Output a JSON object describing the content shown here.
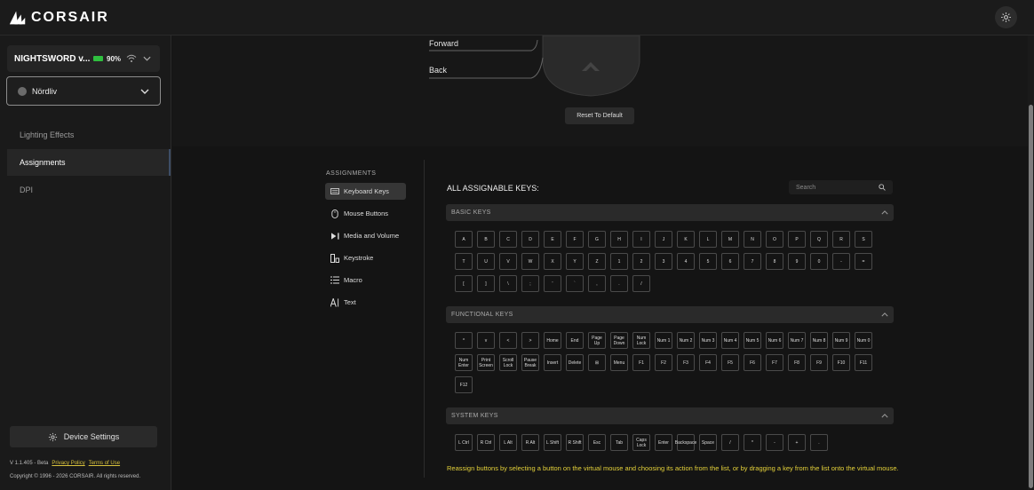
{
  "app": {
    "logo_text": "CORSAIR"
  },
  "device": {
    "name": "NIGHTSWORD v...",
    "battery": "90%"
  },
  "profile": {
    "name": "Nördliv"
  },
  "nav": [
    {
      "label": "Lighting Effects",
      "active": false
    },
    {
      "label": "Assignments",
      "active": true
    },
    {
      "label": "DPI",
      "active": false
    }
  ],
  "device_settings_label": "Device Settings",
  "footer": {
    "version": "V 1.1.405 - Beta",
    "privacy": "Privacy Policy",
    "terms": "Terms of Use",
    "copyright": "Copyright © 1996 - 2026 CORSAIR. All rights reserved."
  },
  "mouse_view": {
    "forward": "Forward",
    "back": "Back",
    "reset": "Reset To Default"
  },
  "assignments": {
    "title": "ASSIGNMENTS",
    "categories": [
      {
        "label": "Keyboard Keys",
        "icon": "keyboard-icon",
        "active": true
      },
      {
        "label": "Mouse Buttons",
        "icon": "mouse-icon",
        "active": false
      },
      {
        "label": "Media and Volume",
        "icon": "media-icon",
        "active": false
      },
      {
        "label": "Keystroke",
        "icon": "keystroke-icon",
        "active": false
      },
      {
        "label": "Macro",
        "icon": "macro-icon",
        "active": false
      },
      {
        "label": "Text",
        "icon": "text-icon",
        "active": false
      }
    ]
  },
  "keys_panel": {
    "title": "ALL ASSIGNABLE KEYS:",
    "search_placeholder": "Search",
    "sections": [
      {
        "title": "BASIC KEYS",
        "rows": [
          [
            "A",
            "B",
            "C",
            "D",
            "E",
            "F",
            "G",
            "H",
            "I",
            "J",
            "K",
            "L",
            "M",
            "N",
            "O",
            "P",
            "Q",
            "R",
            "S"
          ],
          [
            "T",
            "U",
            "V",
            "W",
            "X",
            "Y",
            "Z",
            "1",
            "2",
            "3",
            "4",
            "5",
            "6",
            "7",
            "8",
            "9",
            "0",
            "-",
            "="
          ],
          [
            "[",
            "]",
            "\\",
            ";",
            "'",
            "`",
            ",",
            ".",
            "/"
          ]
        ]
      },
      {
        "title": "FUNCTIONAL KEYS",
        "rows": [
          [
            "^",
            "v",
            "<",
            ">",
            "Home",
            "End",
            "Page Up",
            "Page Down",
            "Num Lock",
            "Num 1",
            "Num 2",
            "Num 3",
            "Num 4",
            "Num 5",
            "Num 6",
            "Num 7",
            "Num 8",
            "Num 9",
            "Num 0"
          ],
          [
            "Num Enter",
            "Print Screen",
            "Scroll Lock",
            "Pause Break",
            "Insert",
            "Delete",
            "⊞",
            "Menu",
            "F1",
            "F2",
            "F3",
            "F4",
            "F5",
            "F6",
            "F7",
            "F8",
            "F9",
            "F10",
            "F11"
          ],
          [
            "F12"
          ]
        ]
      },
      {
        "title": "SYSTEM KEYS",
        "rows": [
          [
            "L Ctrl",
            "R Ctrl",
            "L Alt",
            "R Alt",
            "L Shift",
            "R Shift",
            "Esc",
            "Tab",
            "Caps Lock",
            "Enter",
            "Backspace",
            "Space",
            "/",
            "*",
            "-",
            "+",
            "."
          ]
        ]
      }
    ],
    "hint": "Reassign buttons by selecting a button on the virtual mouse and choosing its action from the list, or by dragging a key from the list onto the virtual mouse."
  }
}
